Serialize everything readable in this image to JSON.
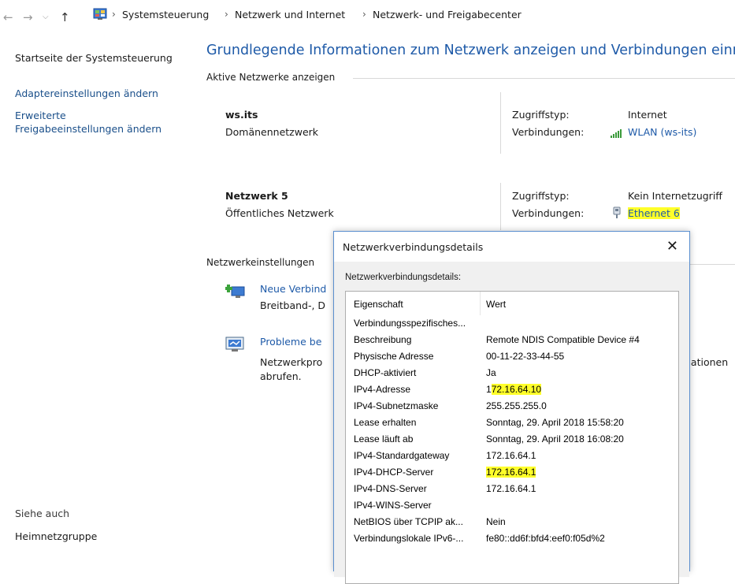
{
  "address_bar": {
    "breadcrumbs": [
      "Systemsteuerung",
      "Netzwerk und Internet",
      "Netzwerk- und Freigabecenter"
    ]
  },
  "left_pane": {
    "home_link": "Startseite der Systemsteuerung",
    "adapter_link": "Adaptereinstellungen ändern",
    "sharing_link_line1": "Erweiterte",
    "sharing_link_line2": "Freigabeeinstellungen ändern",
    "see_also": "Siehe auch",
    "homegroup": "Heimnetzgruppe"
  },
  "main": {
    "title": "Grundlegende Informationen zum Netzwerk anzeigen und Verbindungen einr",
    "active_networks_heading": "Aktive Netzwerke anzeigen",
    "networks": [
      {
        "name": "ws.its",
        "type": "Domänennetzwerk",
        "access_label": "Zugriffstyp:",
        "access_value": "Internet",
        "connections_label": "Verbindungen:",
        "connection": "WLAN (ws-its)"
      },
      {
        "name": "Netzwerk 5",
        "type": "Öffentliches Netzwerk",
        "access_label": "Zugriffstyp:",
        "access_value": "Kein Internetzugriff",
        "connections_label": "Verbindungen:",
        "connection": "Ethernet 6"
      }
    ],
    "settings_heading": "Netzwerkeinstellungen",
    "new_connection_link": "Neue Verbind",
    "new_connection_desc": "Breitband-, D",
    "troubleshoot_link": "Probleme be",
    "troubleshoot_desc_line1": "Netzwerkpro",
    "troubleshoot_desc_line1_tail": "nationen",
    "troubleshoot_desc_line2": "abrufen."
  },
  "dialog": {
    "title": "Netzwerkverbindungsdetails",
    "label": "Netzwerkverbindungsdetails:",
    "columns": [
      "Eigenschaft",
      "Wert"
    ],
    "rows": [
      {
        "p": "Verbindungsspezifisches...",
        "v": ""
      },
      {
        "p": "Beschreibung",
        "v": "Remote NDIS Compatible Device #4"
      },
      {
        "p": "Physische Adresse",
        "v": "00-11-22-33-44-55"
      },
      {
        "p": "DHCP-aktiviert",
        "v": "Ja"
      },
      {
        "p": "IPv4-Adresse",
        "v_pre": "1",
        "v_hl": "72.16.64.10"
      },
      {
        "p": "IPv4-Subnetzmaske",
        "v": "255.255.255.0"
      },
      {
        "p": "Lease erhalten",
        "v": "Sonntag, 29. April 2018 15:58:20"
      },
      {
        "p": "Lease läuft ab",
        "v": "Sonntag, 29. April 2018 16:08:20"
      },
      {
        "p": "IPv4-Standardgateway",
        "v": "172.16.64.1"
      },
      {
        "p": "IPv4-DHCP-Server",
        "v_hl": "172.16.64.1"
      },
      {
        "p": "IPv4-DNS-Server",
        "v": "172.16.64.1"
      },
      {
        "p": "IPv4-WINS-Server",
        "v": ""
      },
      {
        "p": "NetBIOS über TCPIP ak...",
        "v": "Nein"
      },
      {
        "p": "Verbindungslokale IPv6-...",
        "v": "fe80::dd6f:bfd4:eef0:f05d%2"
      }
    ]
  },
  "colors": {
    "link": "#1e5aa8",
    "highlight": "#ffff2a",
    "dialog_border": "#5b8fcf"
  },
  "icons": [
    "back-arrow-icon",
    "forward-arrow-icon",
    "recent-dropdown-icon",
    "up-arrow-icon",
    "control-panel-icon",
    "wifi-signal-icon",
    "ethernet-icon",
    "new-connection-icon",
    "troubleshoot-icon",
    "close-icon"
  ]
}
